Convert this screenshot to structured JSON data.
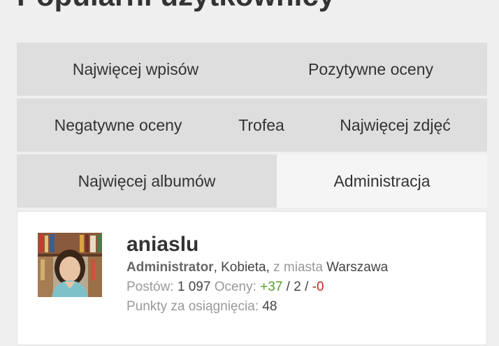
{
  "page": {
    "title": "Popularni użytkownicy"
  },
  "tabs": {
    "most_posts": "Najwięcej wpisów",
    "positive_ratings": "Pozytywne oceny",
    "negative_ratings": "Negatywne oceny",
    "trophies": "Trofea",
    "most_photos": "Najwięcej zdjęć",
    "most_albums": "Najwięcej albumów",
    "administration": "Administracja",
    "active": "Administracja"
  },
  "user": {
    "username": "aniaslu",
    "role": "Administrator",
    "gender_text": ", Kobieta, ",
    "city_prefix": "z miasta ",
    "city": "Warszawa",
    "posts_label": "Postów: ",
    "posts_value": "1 097",
    "ratings_label": " Oceny: ",
    "ratings_positive": "+37",
    "ratings_separator1": " / ",
    "ratings_neutral": "2",
    "ratings_separator2": " / ",
    "ratings_negative": "-0",
    "points_label": "Punkty za osiągnięcia: ",
    "points_value": "48"
  },
  "colors": {
    "positive": "#5aa02c",
    "negative": "#d0231b",
    "tab_background": "#dedede",
    "tab_active_background": "#f5f5f5"
  }
}
